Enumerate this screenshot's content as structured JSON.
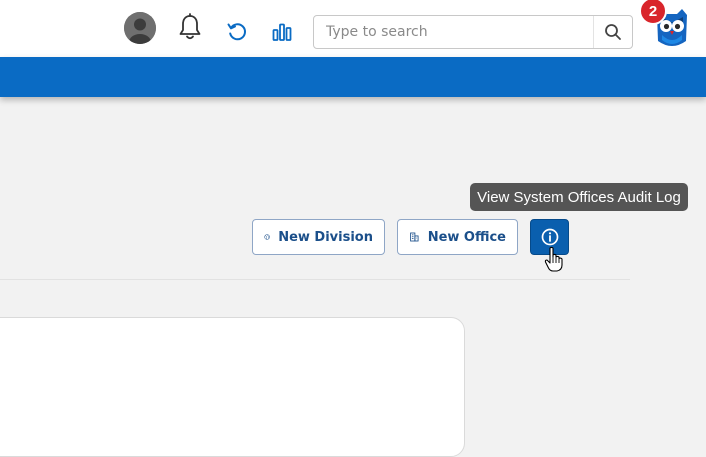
{
  "header": {
    "search": {
      "placeholder": "Type to search",
      "value": ""
    },
    "notification_badge": "2",
    "icons": {
      "avatar": "user-avatar",
      "bell": "bell-icon",
      "undo": "undo-icon",
      "stats": "bar-chart-icon",
      "search": "search-icon",
      "logo": "owl-logo"
    }
  },
  "toolbar": {
    "tooltip": "View System Offices Audit Log",
    "new_division_label": "New Division",
    "new_office_label": "New Office",
    "info_icon": "info-icon"
  },
  "colors": {
    "primary_blue": "#0a6bc4",
    "button_text": "#1b4f8a",
    "badge_red": "#d9252b",
    "tooltip_bg": "#555555",
    "page_bg": "#f2f2f2"
  }
}
